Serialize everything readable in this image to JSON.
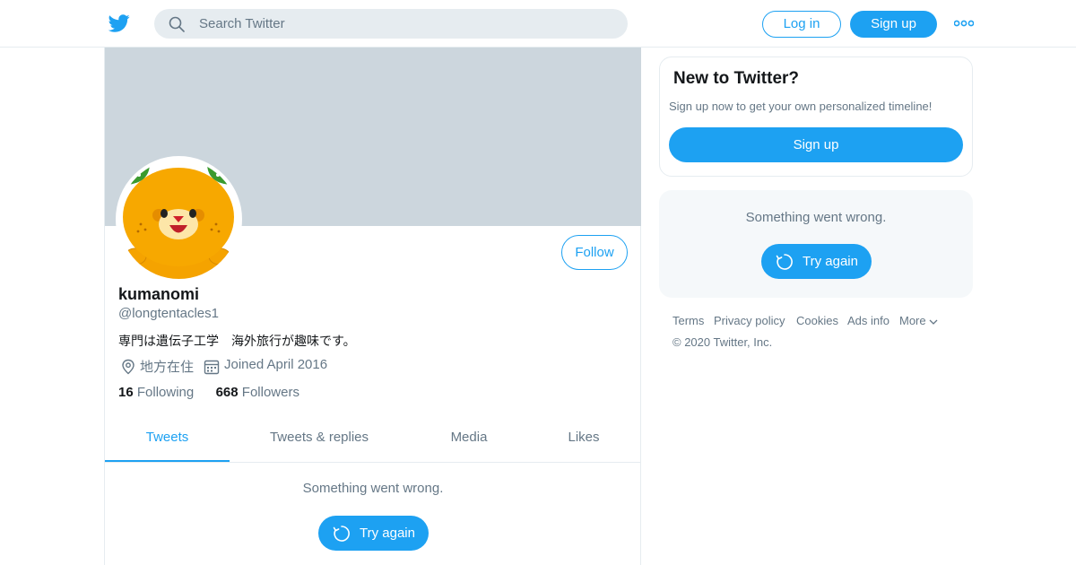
{
  "header": {
    "logo_icon": "twitter-bird-icon",
    "search_placeholder": "Search Twitter",
    "login_label": "Log in",
    "signup_label": "Sign up",
    "more_icon": "more-dots-icon"
  },
  "profile": {
    "name": "kumanomi",
    "handle": "@longtentacles1",
    "bio": "専門は遺伝子工学　海外旅行が趣味です。",
    "location": "地方在住",
    "joined": "Joined April 2016",
    "following_count": "16",
    "following_label": "Following",
    "followers_count": "668",
    "followers_label": "Followers",
    "follow_label": "Follow"
  },
  "tabs": [
    {
      "label": "Tweets",
      "active": true
    },
    {
      "label": "Tweets & replies",
      "active": false
    },
    {
      "label": "Media",
      "active": false
    },
    {
      "label": "Likes",
      "active": false
    }
  ],
  "timeline": {
    "error": "Something went wrong.",
    "retry_label": "Try again"
  },
  "sidebar": {
    "new_title": "New to Twitter?",
    "new_text": "Sign up now to get your own personalized timeline!",
    "signup_label": "Sign up",
    "error": "Something went wrong.",
    "retry_label": "Try again"
  },
  "footer": {
    "links": [
      "Terms",
      "Privacy policy",
      "Cookies",
      "Ads info",
      "More"
    ],
    "copyright": "© 2020 Twitter, Inc."
  },
  "colors": {
    "accent": "#1da1f2",
    "banner": "#ccd6dd",
    "secondary_text": "#657786"
  }
}
